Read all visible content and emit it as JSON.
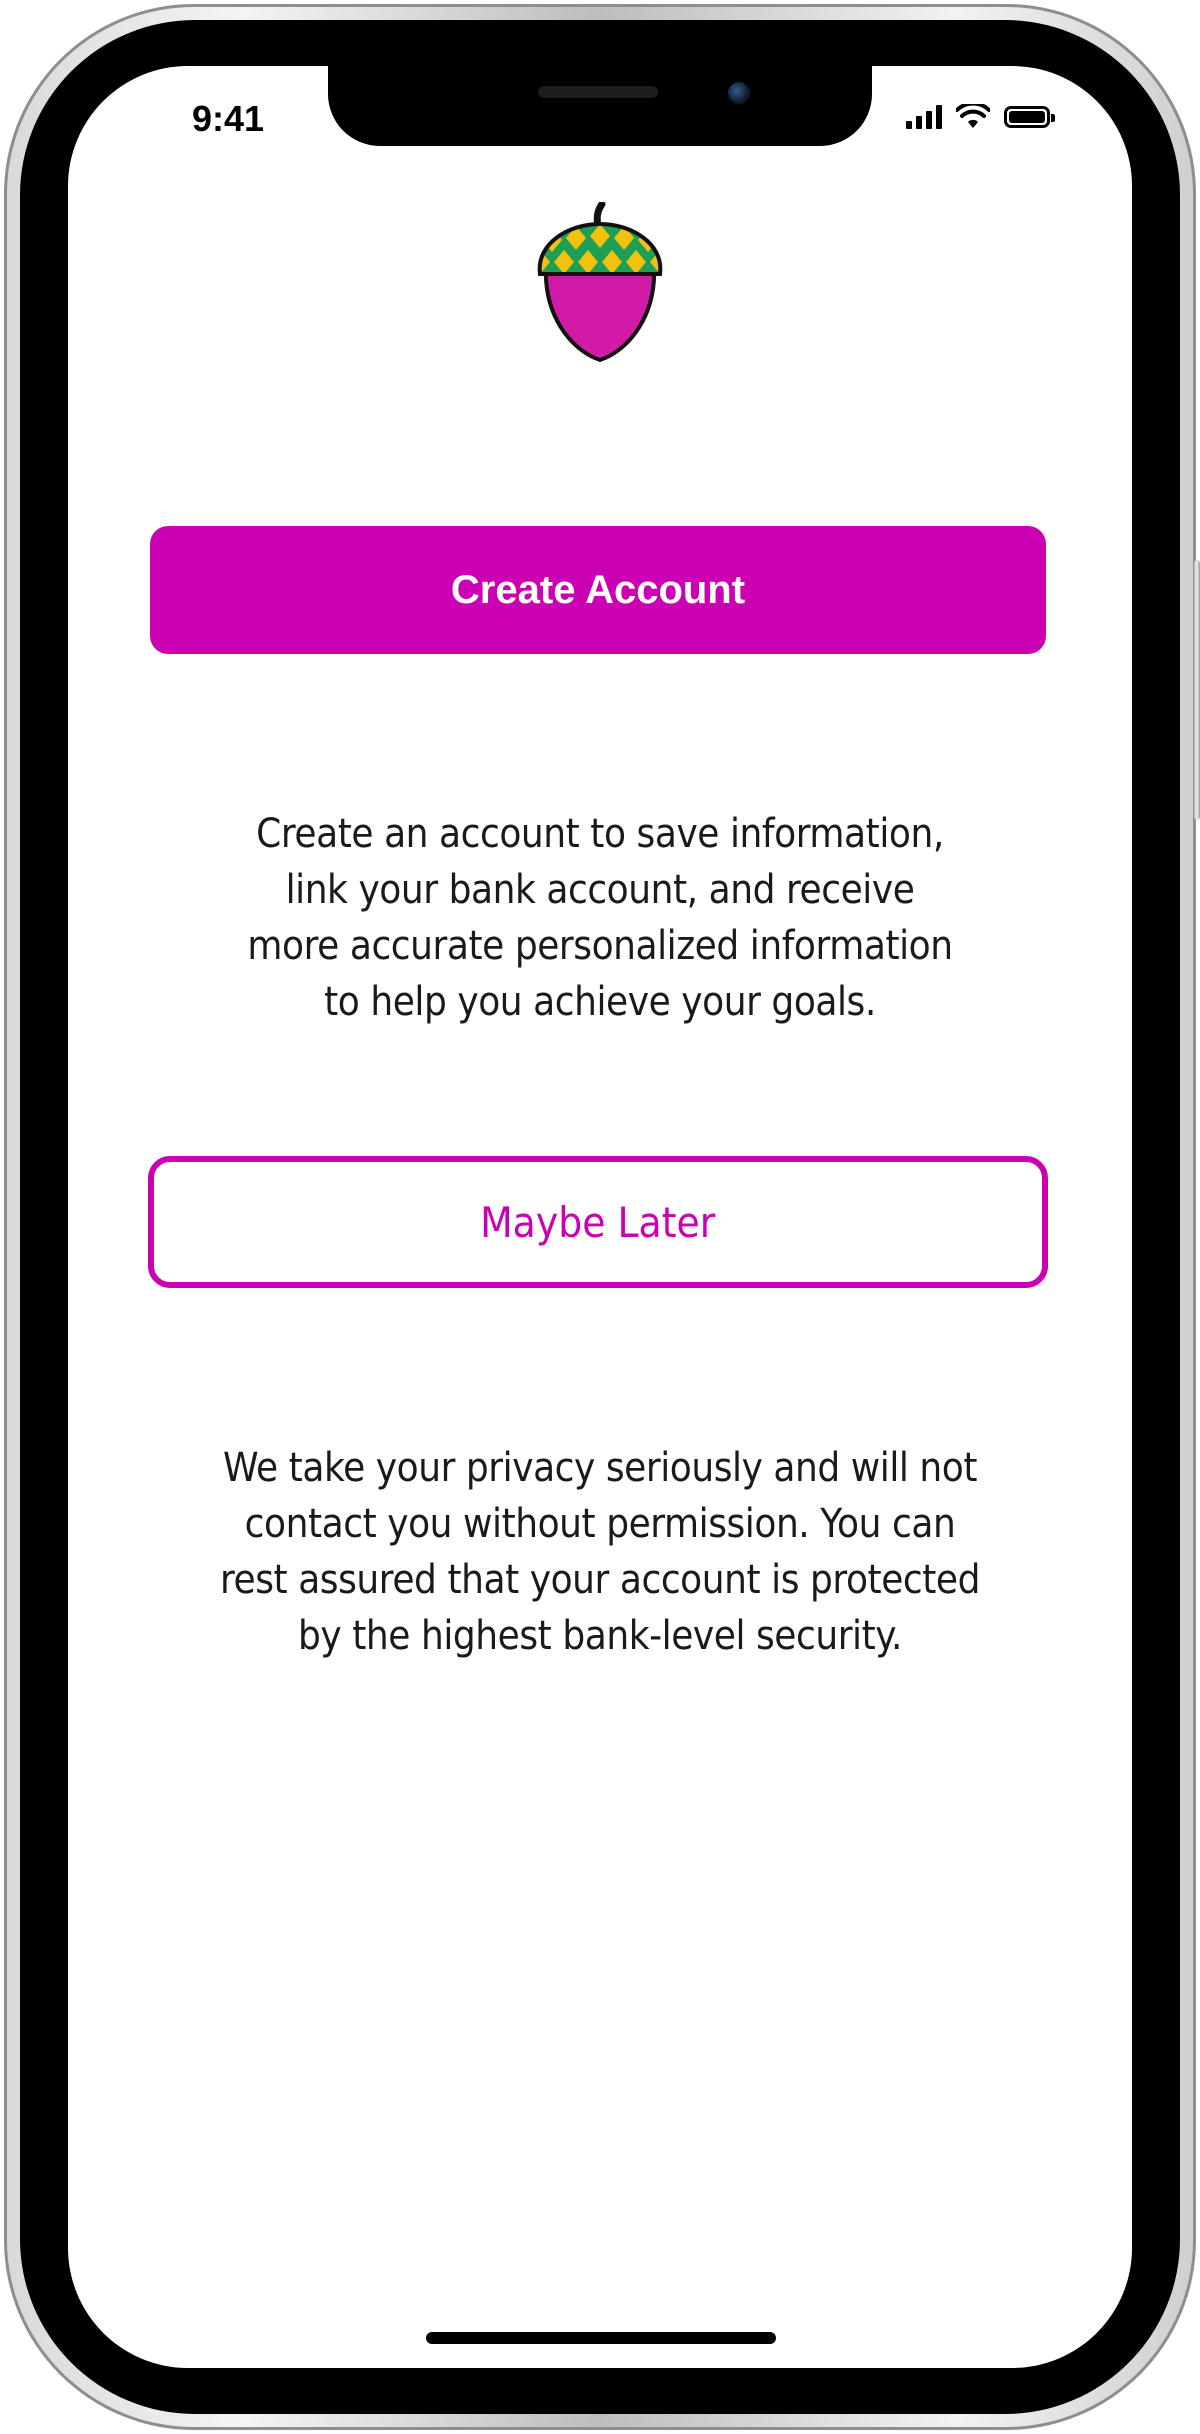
{
  "status_bar": {
    "time": "9:41",
    "icons": [
      "cellular-signal-icon",
      "wifi-icon",
      "battery-icon"
    ]
  },
  "logo": {
    "icon": "acorn-logo-icon",
    "colors": {
      "cap_green": "#1f9e55",
      "cap_yellow": "#f2c20f",
      "nut_magenta": "#d21aa8"
    }
  },
  "create_account": {
    "label": "Create Account"
  },
  "intro": {
    "text": "Create an account to save information,\nlink your bank account, and receive\nmore accurate personalized information\nto help you achieve your goals."
  },
  "maybe_later": {
    "label": "Maybe Later"
  },
  "privacy": {
    "text": "We take your privacy seriously and will not\ncontact you without permission. You can\nrest assured that your account is protected\nby the highest bank-level security."
  },
  "theme": {
    "accent": "#cc00b3",
    "text": "#1a1a1a",
    "background": "#ffffff"
  }
}
